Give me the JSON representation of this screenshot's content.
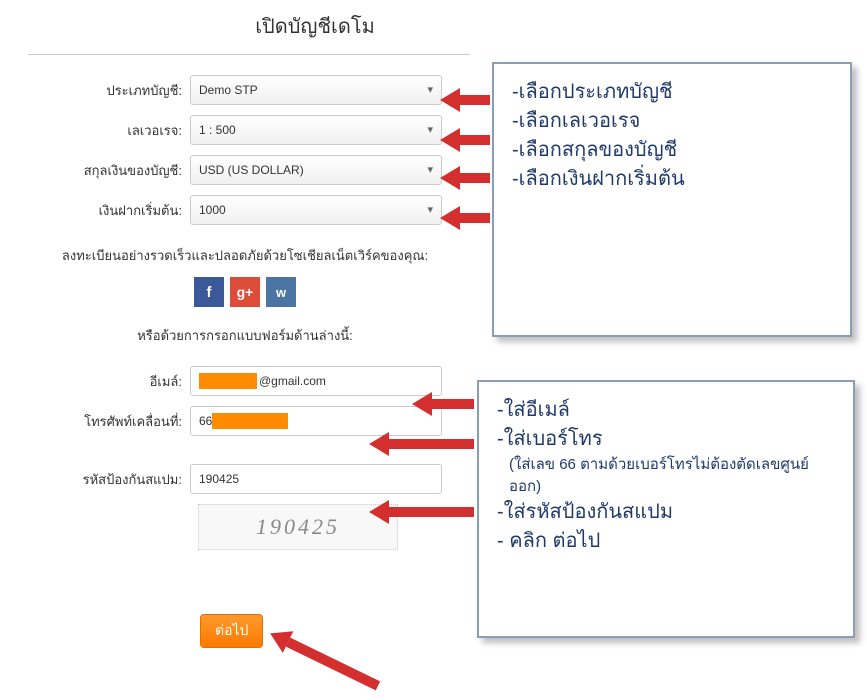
{
  "page_title": "เปิดบัญชีเดโม",
  "fields": {
    "account_type": {
      "label": "ประเภทบัญชี:",
      "value": "Demo STP"
    },
    "leverage": {
      "label": "เลเวอเรจ:",
      "value": "1 : 500"
    },
    "currency": {
      "label": "สกุลเงินของบัญชี:",
      "value": "USD (US DOLLAR)"
    },
    "deposit": {
      "label": "เงินฝากเริ่มต้น:",
      "value": "1000"
    },
    "email": {
      "label": "อีเมล์:",
      "suffix": "@gmail.com"
    },
    "phone": {
      "label": "โทรศัพท์เคลื่อนที่:",
      "prefix": "66"
    },
    "captcha": {
      "label": "รหัสป้องกันสแปม:",
      "value": "190425",
      "image_text": "190425"
    }
  },
  "social": {
    "register_text": "ลงทะเบียนอย่างรวดเร็วและปลอดภัยด้วยโซเชียลเน็ตเวิร์คของคุณ:",
    "or_text": "หรือด้วยการกรอกแบบฟอร์มด้านล่างนี้:",
    "fb": "f",
    "gp": "g+",
    "vk": "w"
  },
  "submit_label": "ต่อไป",
  "callouts": {
    "top": [
      "-เลือกประเภทบัญชี",
      "-เลือกเลเวอเรจ",
      "-เลือกสกุลของบัญชี",
      "-เลือกเงินฝากเริ่มต้น"
    ],
    "bottom": {
      "line1": "-ใส่อีเมล์",
      "line2": "-ใส่เบอร์โทร",
      "line2_sub": "(ใส่เลข 66 ตามด้วยเบอร์โทรไม่ต้องตัดเลขศูนย์ออก)",
      "line3": "-ใส่รหัสป้องกันสแปม",
      "line4": "- คลิก ต่อไป"
    }
  }
}
